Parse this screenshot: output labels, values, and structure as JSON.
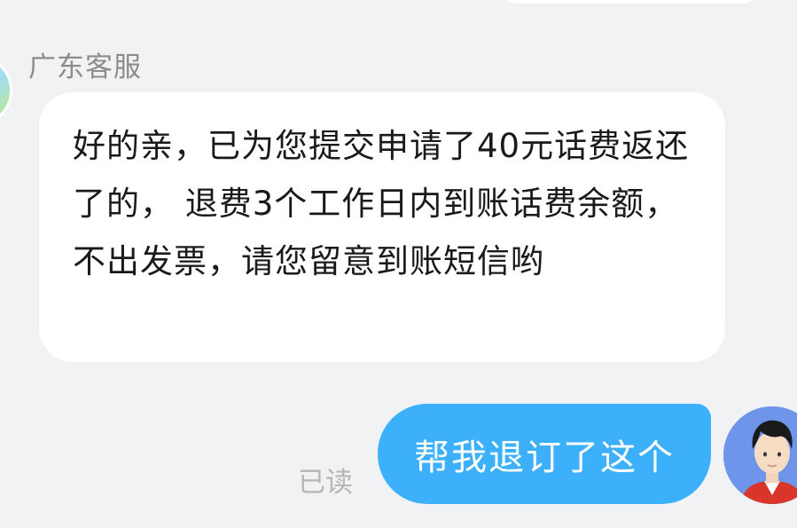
{
  "agent": {
    "name": "广东客服",
    "message": "好的亲，已为您提交申请了40元话费返还了的， 退费3个工作日内到账话费余额，不出发票，请您留意到账短信哟"
  },
  "user": {
    "message": "帮我退订了这个",
    "read_status": "已读"
  },
  "colors": {
    "background": "#f1f2f4",
    "agent_bubble": "#ffffff",
    "user_bubble": "#3cb0fa",
    "user_avatar_bg": "#6e95ea"
  }
}
